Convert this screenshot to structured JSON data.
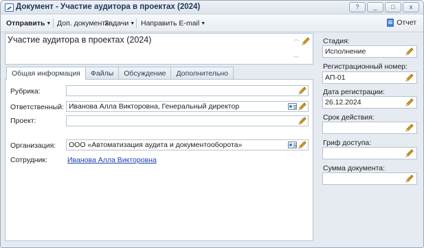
{
  "window": {
    "title": "Документ - Участие аудитора в проектах (2024)",
    "controls": [
      "?",
      "_",
      "□",
      "x"
    ]
  },
  "toolbar": {
    "send": "Отправить",
    "extra_docs": "Доп. документы",
    "tasks": "Задачи",
    "send_email": "Направить E-mail",
    "report": "Отчет"
  },
  "subject": {
    "value": "Участие аудитора в проектах (2024)"
  },
  "tabs": [
    {
      "label": "Общая информация",
      "active": true
    },
    {
      "label": "Файлы",
      "active": false
    },
    {
      "label": "Обсуждение",
      "active": false
    },
    {
      "label": "Дополнительно",
      "active": false
    }
  ],
  "general": {
    "rubric_label": "Рубрика:",
    "rubric_value": "",
    "responsible_label": "Ответственный:",
    "responsible_value": "Иванова Алла Викторовна, Генеральный директор",
    "project_label": "Проект:",
    "project_value": "",
    "organization_label": "Организация:",
    "organization_value": "ООО «Автоматизация аудита и документооборота»",
    "employee_label": "Сотрудник:",
    "employee_value": "Иванова Алла Викторовна"
  },
  "side": {
    "stage_label": "Стадия:",
    "stage_value": "Исполнение",
    "reg_number_label": "Регистрационный номер:",
    "reg_number_value": "АП-01",
    "reg_date_label": "Дата регистрации:",
    "reg_date_value": "26.12.2024",
    "validity_label": "Срок действия:",
    "validity_value": "",
    "access_label": "Гриф доступа:",
    "access_value": "",
    "amount_label": "Сумма документа:",
    "amount_value": ""
  },
  "colors": {
    "accent": "#3d7bd0",
    "link": "#1a3fb0",
    "pencil": "#e0a21a"
  }
}
